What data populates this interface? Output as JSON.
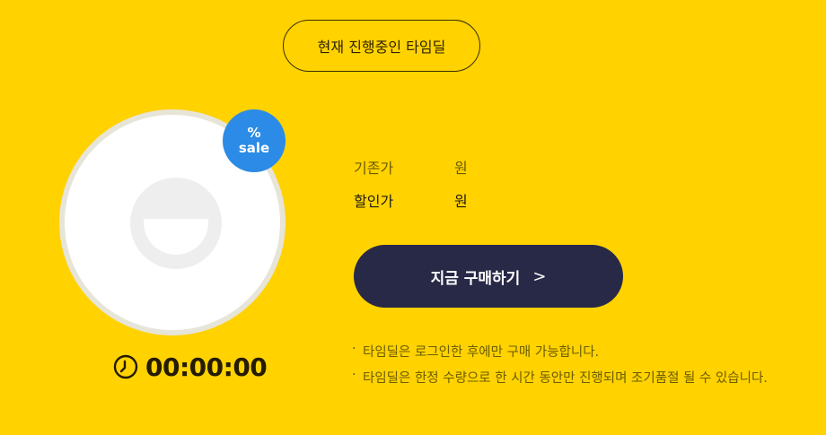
{
  "header": {
    "title": "현재 진행중인 타임딜"
  },
  "product": {
    "image_icon": "product-placeholder-icon",
    "badge": {
      "percent_symbol": "%",
      "label": "sale",
      "color": "#2b8be6"
    }
  },
  "timer": {
    "icon": "clock-icon",
    "value": "00:00:00"
  },
  "price": {
    "original_label": "기존가",
    "original_unit": "원",
    "sale_label": "할인가",
    "sale_unit": "원"
  },
  "buy": {
    "label": "지금 구매하기",
    "chevron": ">"
  },
  "notes": [
    {
      "bullet": "·",
      "text": "타임딜은 로그인한 후에만 구매 가능합니다."
    },
    {
      "bullet": "·",
      "text": "타임딜은 한정 수량으로 한 시간 동안만 진행되며 조기품절 될 수 있습니다."
    }
  ],
  "colors": {
    "background": "#ffd200",
    "button": "#282947",
    "badge": "#2b8be6"
  }
}
